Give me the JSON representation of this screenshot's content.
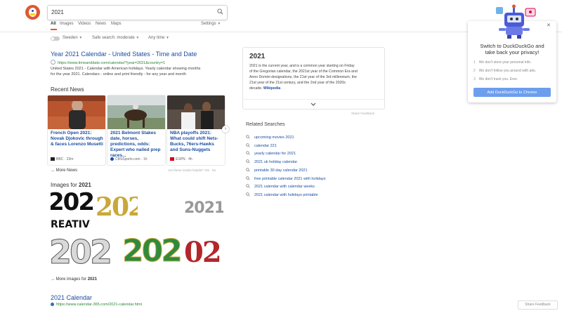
{
  "search": {
    "query": "2021"
  },
  "tabs": [
    {
      "label": "All"
    },
    {
      "label": "Images"
    },
    {
      "label": "Videos"
    },
    {
      "label": "News"
    },
    {
      "label": "Maps"
    }
  ],
  "settings_label": "Settings",
  "filters": {
    "region": "Sweden",
    "safe_search": "Safe search: moderate",
    "time": "Any time"
  },
  "result1": {
    "title": "Year 2021 Calendar - United States - Time and Date",
    "url": "https://www.timeanddate.com/calendar/?year=2021&country=1",
    "snippet_line1": "United States 2021 - Calendar with American holidays. Yearly calendar showing months",
    "snippet_line2": "for the year 2021. Calendars - online and print friendly - for any year and month"
  },
  "news": {
    "heading": "Recent News",
    "cards": [
      {
        "title": "French Open 2021: Novak Djokovic through & faces Lorenzo Musetti",
        "source": "BBC",
        "time": "23m"
      },
      {
        "title": "2021 Belmont Stakes date, horses, predictions, odds: Expert who nailed prep races...",
        "source": "CBSSports.com",
        "time": "1h"
      },
      {
        "title": "NBA playoffs 2021: What could shift Nets-Bucks, 76ers-Hawks and Suns-Nuggets",
        "source": "ESPN",
        "time": "4h"
      }
    ],
    "more": "More News",
    "helpful": "Are these results helpful?",
    "yes": "Yes",
    "no": "No"
  },
  "images": {
    "heading_prefix": "Images for",
    "heading_term": "2021",
    "tiles": [
      {
        "text": "202"
      },
      {
        "text": "202"
      },
      {
        "text": "2021"
      },
      {
        "text": "202"
      },
      {
        "text": "202"
      },
      {
        "text": "02"
      }
    ],
    "tile1_sub": "REATIV",
    "more_prefix": "More images for",
    "more_term": "2021"
  },
  "result2": {
    "title": "2021 Calendar",
    "url": "https://www.calendar-365.com/2021-calendar.html"
  },
  "knowledge": {
    "title": "2021",
    "lines": [
      "2021 is the current year, and is a common year starting on Friday",
      "of the Gregorian calendar, the 2021st year of the Common Era and",
      "Anno Domini designations, the 21st year of the 3rd millennium, the",
      "21st year of the 21st century, and the 2nd year of the 2020s",
      "decade."
    ],
    "source": "Wikipedia",
    "share_feedback": "Share Feedback"
  },
  "related": {
    "heading": "Related Searches",
    "items": [
      "upcoming movies 2021",
      "calendar 221",
      "yearly calendar for 2021",
      "2021 uk holiday calendar",
      "printable 30 day calendar 2021",
      "free printable calendar 2021 with holidays",
      "2021 calendar with calendar weeks",
      "2021 calendar with holidays printable"
    ]
  },
  "promo": {
    "title_line1": "Switch to DuckDuckGo and",
    "title_line2": "take back your privacy!",
    "points": [
      {
        "n": "1",
        "text": "We don't store your personal info."
      },
      {
        "n": "2",
        "text": "We don't follow you around with ads."
      },
      {
        "n": "3",
        "text": "We don't track you. Ever."
      }
    ],
    "button": "Add DuckDuckGo to Chrome"
  },
  "bottom_feedback": "Share Feedback",
  "colors": {
    "brand": "#de5833",
    "link": "#1a4ea1",
    "url": "#2d8536",
    "button": "#6d9eed"
  }
}
